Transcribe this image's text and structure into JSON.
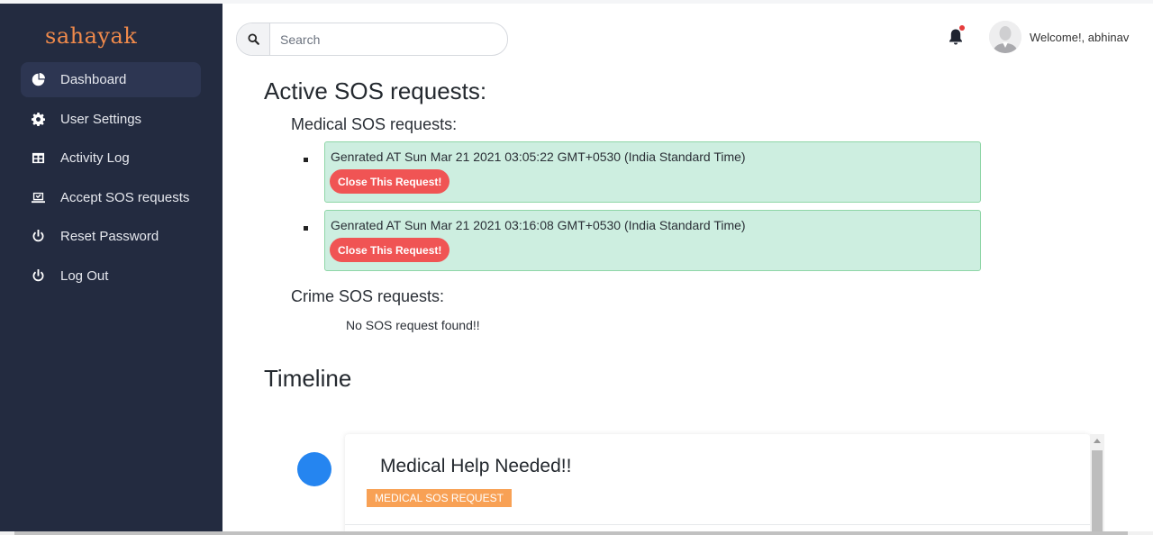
{
  "sidebar": {
    "logo": "sahayak",
    "items": [
      {
        "label": "Dashboard",
        "icon": "pie-chart-icon",
        "active": true
      },
      {
        "label": "User Settings",
        "icon": "gear-icon"
      },
      {
        "label": "Activity Log",
        "icon": "table-icon"
      },
      {
        "label": "Accept SOS requests",
        "icon": "laptop-check-icon"
      },
      {
        "label": "Reset Password",
        "icon": "power-icon"
      },
      {
        "label": "Log Out",
        "icon": "power-icon"
      }
    ]
  },
  "header": {
    "search_placeholder": "Search",
    "search_icon": "search-icon",
    "notification_icon": "bell-icon",
    "welcome": "Welcome!, abhinav"
  },
  "main": {
    "active_title": "Active SOS requests:",
    "medical_title": "Medical SOS requests:",
    "medical_requests": [
      {
        "text": "Genrated AT Sun Mar 21 2021 03:05:22 GMT+0530 (India Standard Time)",
        "button": "Close This Request!"
      },
      {
        "text": "Genrated AT Sun Mar 21 2021 03:16:08 GMT+0530 (India Standard Time)",
        "button": "Close This Request!"
      }
    ],
    "crime_title": "Crime SOS requests:",
    "crime_empty": "No SOS request found!!",
    "timeline_title": "Timeline",
    "timeline_items": [
      {
        "title": "Medical Help Needed!!",
        "badge": "MEDICAL SOS REQUEST"
      }
    ]
  },
  "colors": {
    "sidebar_bg": "#232b40",
    "logo": "#f08a4b",
    "card_bg": "#cdeee0",
    "card_border": "#8fd6a7",
    "close_button": "#f05454",
    "timeline_dot": "#2585f0",
    "badge": "#f8a155"
  }
}
